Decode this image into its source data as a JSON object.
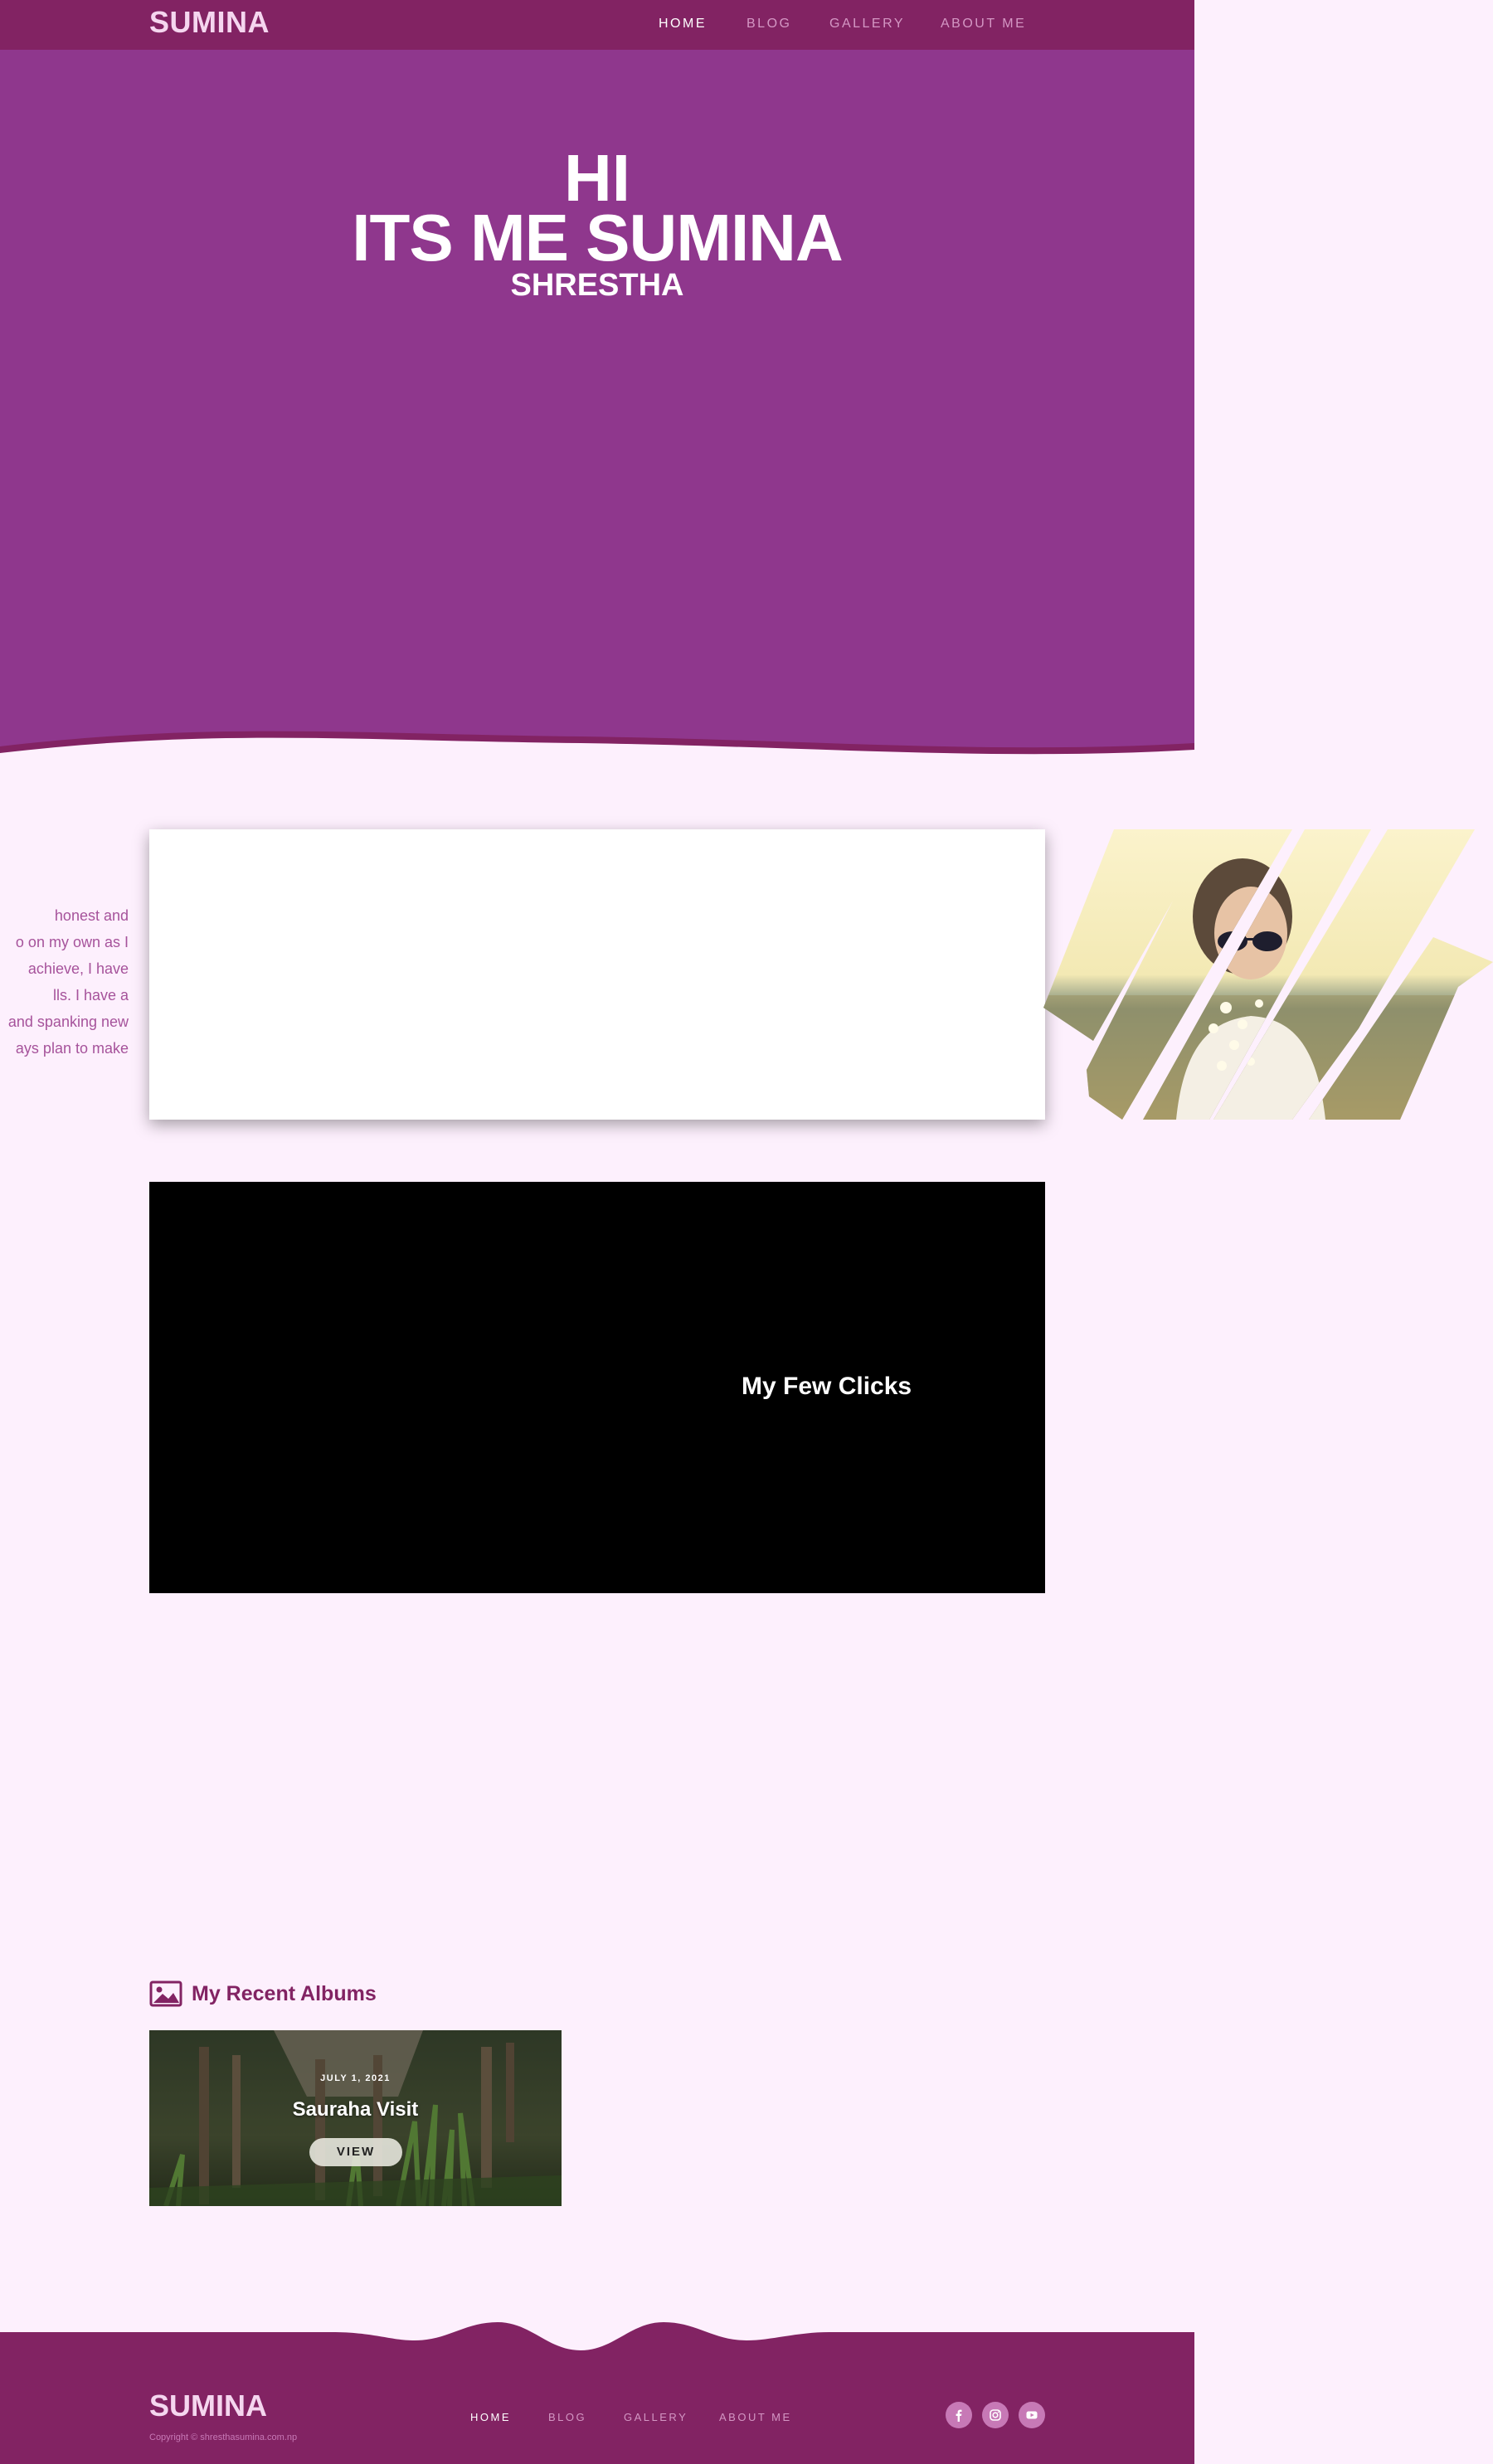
{
  "header": {
    "brand": "SUMINA",
    "nav": [
      {
        "label": "HOME",
        "active": true
      },
      {
        "label": "BLOG",
        "active": false
      },
      {
        "label": "GALLERY",
        "active": false
      },
      {
        "label": "ABOUT ME",
        "active": false
      }
    ]
  },
  "hero": {
    "line1": "HI",
    "line2": "ITS ME SUMINA",
    "line3": "SHRESTHA"
  },
  "intro": {
    "lines": [
      "honest and",
      "o on my own as I",
      "achieve, I have",
      "lls. I have a",
      "and spanking new",
      "ays plan to make"
    ]
  },
  "video": {
    "caption": "My Few Clicks"
  },
  "albums": {
    "heading": "My Recent Albums",
    "items": [
      {
        "date": "JULY 1, 2021",
        "title": "Sauraha Visit",
        "button": "VIEW"
      }
    ]
  },
  "footer": {
    "brand": "SUMINA",
    "copyright": "Copyright © shresthasumina.com.np",
    "nav": [
      {
        "label": "HOME",
        "active": true
      },
      {
        "label": "BLOG",
        "active": false
      },
      {
        "label": "GALLERY",
        "active": false
      },
      {
        "label": "ABOUT ME",
        "active": false
      }
    ],
    "social": [
      "facebook-icon",
      "instagram-icon",
      "youtube-icon"
    ]
  },
  "colors": {
    "header_bg": "#822363",
    "hero_bg": "#8f378d",
    "page_bg": "#fdf0fd",
    "accent_text": "#a6539b"
  }
}
